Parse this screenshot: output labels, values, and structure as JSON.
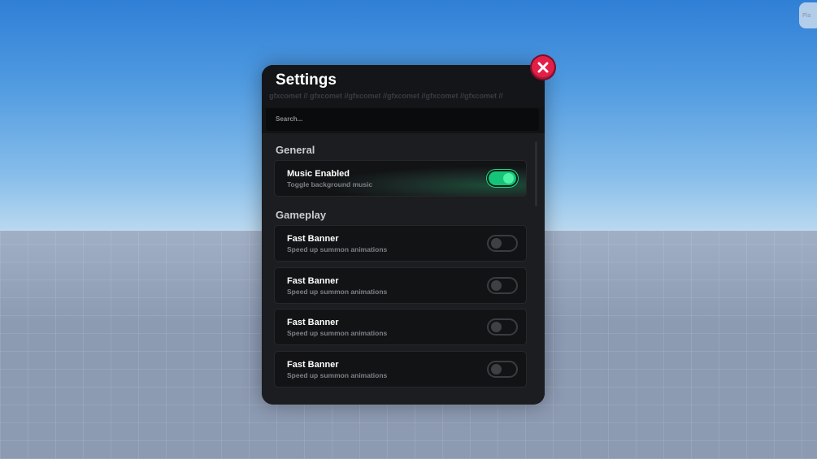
{
  "corner_button": {
    "label": "Pla"
  },
  "settings": {
    "title": "Settings",
    "marquee": "gfxcomet // gfxcomet //gfxcomet //gfxcomet //gfxcomet //gfxcomet //",
    "search_placeholder": "Search..."
  },
  "sections": {
    "general": {
      "label": "General",
      "items": [
        {
          "title": "Music Enabled",
          "description": "Toggle background music",
          "enabled": true
        }
      ]
    },
    "gameplay": {
      "label": "Gameplay",
      "items": [
        {
          "title": "Fast Banner",
          "description": "Speed up summon animations",
          "enabled": false
        },
        {
          "title": "Fast Banner",
          "description": "Speed up summon animations",
          "enabled": false
        },
        {
          "title": "Fast Banner",
          "description": "Speed up summon animations",
          "enabled": false
        },
        {
          "title": "Fast Banner",
          "description": "Speed up summon animations",
          "enabled": false
        }
      ]
    }
  },
  "icons": {
    "close": "close-icon"
  },
  "colors": {
    "toggle_on": "#14c479",
    "close": "#e21f48",
    "panel": "#121315"
  }
}
